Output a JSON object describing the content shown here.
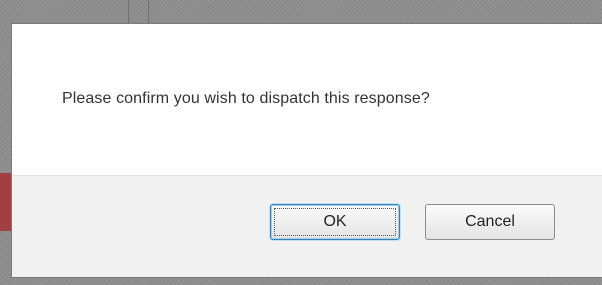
{
  "dialog": {
    "message": "Please confirm you wish to dispatch this response?",
    "ok_label": "OK",
    "cancel_label": "Cancel"
  },
  "colors": {
    "backdrop": "#8e8e8e",
    "dialog_bg": "#ffffff",
    "footer_bg": "#f1f1f1",
    "focus_border": "#3c7fb1",
    "side_strip": "#a04040"
  }
}
